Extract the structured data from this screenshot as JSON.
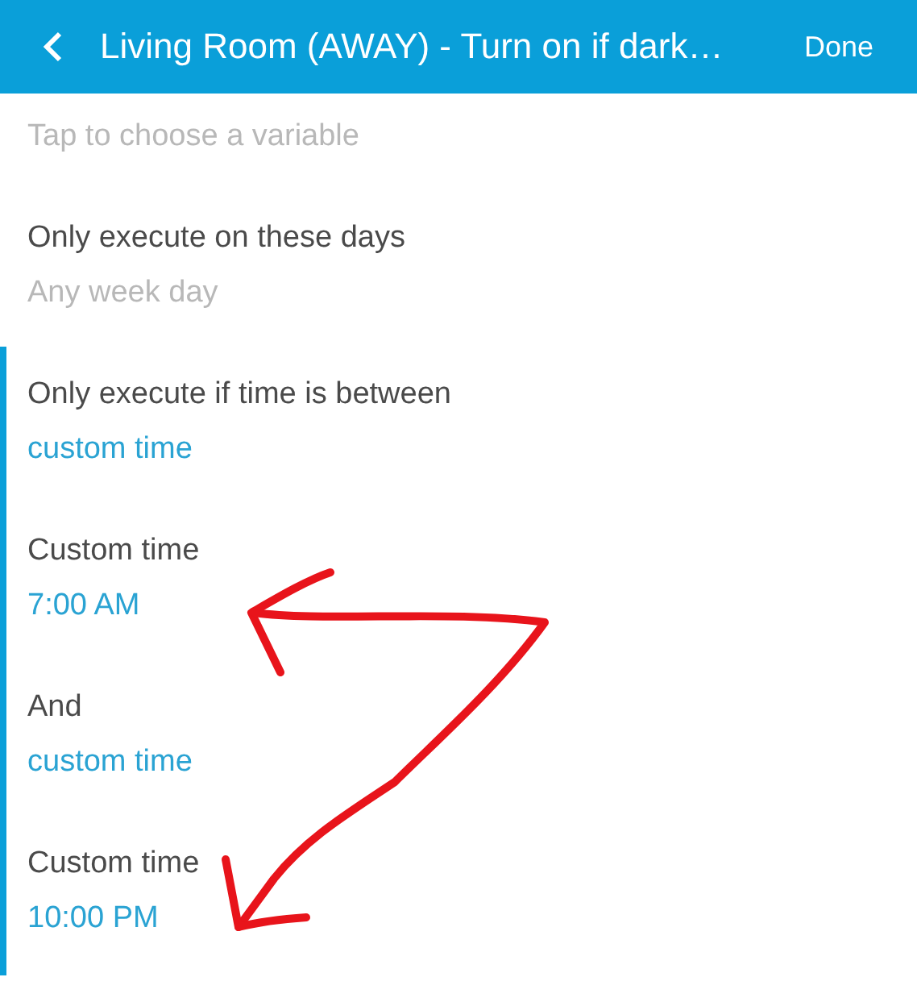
{
  "header": {
    "title": "Living Room (AWAY) - Turn on if dark…",
    "action": "Done"
  },
  "sections": [
    {
      "highlighted": false,
      "items": [
        {
          "value": "Tap to choose a variable",
          "kind": "placeholder"
        },
        {
          "label": "Only execute on these days",
          "value": "Any week day",
          "kind": "placeholder"
        }
      ]
    },
    {
      "highlighted": true,
      "items": [
        {
          "label": "Only execute if time is between",
          "value": "custom time",
          "kind": "link"
        },
        {
          "label": "Custom time",
          "value": "7:00 AM",
          "kind": "link"
        },
        {
          "label": "And",
          "value": "custom time",
          "kind": "link"
        },
        {
          "label": "Custom time",
          "value": "10:00 PM",
          "kind": "link"
        }
      ]
    }
  ]
}
